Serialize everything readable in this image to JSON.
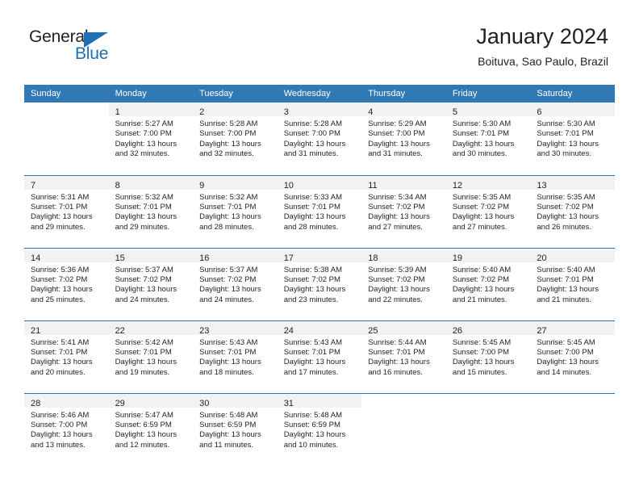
{
  "brand": {
    "name_part1": "General",
    "name_part2": "Blue",
    "accent_color": "#1f6fb4"
  },
  "header": {
    "title": "January 2024",
    "subtitle": "Boituva, Sao Paulo, Brazil"
  },
  "calendar": {
    "header_bg": "#3079b5",
    "daynum_bg": "#f2f2f2",
    "weekdays": [
      "Sunday",
      "Monday",
      "Tuesday",
      "Wednesday",
      "Thursday",
      "Friday",
      "Saturday"
    ],
    "weeks": [
      [
        {
          "day": "",
          "sunrise": "",
          "sunset": "",
          "daylight": ""
        },
        {
          "day": "1",
          "sunrise": "Sunrise: 5:27 AM",
          "sunset": "Sunset: 7:00 PM",
          "daylight": "Daylight: 13 hours and 32 minutes."
        },
        {
          "day": "2",
          "sunrise": "Sunrise: 5:28 AM",
          "sunset": "Sunset: 7:00 PM",
          "daylight": "Daylight: 13 hours and 32 minutes."
        },
        {
          "day": "3",
          "sunrise": "Sunrise: 5:28 AM",
          "sunset": "Sunset: 7:00 PM",
          "daylight": "Daylight: 13 hours and 31 minutes."
        },
        {
          "day": "4",
          "sunrise": "Sunrise: 5:29 AM",
          "sunset": "Sunset: 7:00 PM",
          "daylight": "Daylight: 13 hours and 31 minutes."
        },
        {
          "day": "5",
          "sunrise": "Sunrise: 5:30 AM",
          "sunset": "Sunset: 7:01 PM",
          "daylight": "Daylight: 13 hours and 30 minutes."
        },
        {
          "day": "6",
          "sunrise": "Sunrise: 5:30 AM",
          "sunset": "Sunset: 7:01 PM",
          "daylight": "Daylight: 13 hours and 30 minutes."
        }
      ],
      [
        {
          "day": "7",
          "sunrise": "Sunrise: 5:31 AM",
          "sunset": "Sunset: 7:01 PM",
          "daylight": "Daylight: 13 hours and 29 minutes."
        },
        {
          "day": "8",
          "sunrise": "Sunrise: 5:32 AM",
          "sunset": "Sunset: 7:01 PM",
          "daylight": "Daylight: 13 hours and 29 minutes."
        },
        {
          "day": "9",
          "sunrise": "Sunrise: 5:32 AM",
          "sunset": "Sunset: 7:01 PM",
          "daylight": "Daylight: 13 hours and 28 minutes."
        },
        {
          "day": "10",
          "sunrise": "Sunrise: 5:33 AM",
          "sunset": "Sunset: 7:01 PM",
          "daylight": "Daylight: 13 hours and 28 minutes."
        },
        {
          "day": "11",
          "sunrise": "Sunrise: 5:34 AM",
          "sunset": "Sunset: 7:02 PM",
          "daylight": "Daylight: 13 hours and 27 minutes."
        },
        {
          "day": "12",
          "sunrise": "Sunrise: 5:35 AM",
          "sunset": "Sunset: 7:02 PM",
          "daylight": "Daylight: 13 hours and 27 minutes."
        },
        {
          "day": "13",
          "sunrise": "Sunrise: 5:35 AM",
          "sunset": "Sunset: 7:02 PM",
          "daylight": "Daylight: 13 hours and 26 minutes."
        }
      ],
      [
        {
          "day": "14",
          "sunrise": "Sunrise: 5:36 AM",
          "sunset": "Sunset: 7:02 PM",
          "daylight": "Daylight: 13 hours and 25 minutes."
        },
        {
          "day": "15",
          "sunrise": "Sunrise: 5:37 AM",
          "sunset": "Sunset: 7:02 PM",
          "daylight": "Daylight: 13 hours and 24 minutes."
        },
        {
          "day": "16",
          "sunrise": "Sunrise: 5:37 AM",
          "sunset": "Sunset: 7:02 PM",
          "daylight": "Daylight: 13 hours and 24 minutes."
        },
        {
          "day": "17",
          "sunrise": "Sunrise: 5:38 AM",
          "sunset": "Sunset: 7:02 PM",
          "daylight": "Daylight: 13 hours and 23 minutes."
        },
        {
          "day": "18",
          "sunrise": "Sunrise: 5:39 AM",
          "sunset": "Sunset: 7:02 PM",
          "daylight": "Daylight: 13 hours and 22 minutes."
        },
        {
          "day": "19",
          "sunrise": "Sunrise: 5:40 AM",
          "sunset": "Sunset: 7:02 PM",
          "daylight": "Daylight: 13 hours and 21 minutes."
        },
        {
          "day": "20",
          "sunrise": "Sunrise: 5:40 AM",
          "sunset": "Sunset: 7:01 PM",
          "daylight": "Daylight: 13 hours and 21 minutes."
        }
      ],
      [
        {
          "day": "21",
          "sunrise": "Sunrise: 5:41 AM",
          "sunset": "Sunset: 7:01 PM",
          "daylight": "Daylight: 13 hours and 20 minutes."
        },
        {
          "day": "22",
          "sunrise": "Sunrise: 5:42 AM",
          "sunset": "Sunset: 7:01 PM",
          "daylight": "Daylight: 13 hours and 19 minutes."
        },
        {
          "day": "23",
          "sunrise": "Sunrise: 5:43 AM",
          "sunset": "Sunset: 7:01 PM",
          "daylight": "Daylight: 13 hours and 18 minutes."
        },
        {
          "day": "24",
          "sunrise": "Sunrise: 5:43 AM",
          "sunset": "Sunset: 7:01 PM",
          "daylight": "Daylight: 13 hours and 17 minutes."
        },
        {
          "day": "25",
          "sunrise": "Sunrise: 5:44 AM",
          "sunset": "Sunset: 7:01 PM",
          "daylight": "Daylight: 13 hours and 16 minutes."
        },
        {
          "day": "26",
          "sunrise": "Sunrise: 5:45 AM",
          "sunset": "Sunset: 7:00 PM",
          "daylight": "Daylight: 13 hours and 15 minutes."
        },
        {
          "day": "27",
          "sunrise": "Sunrise: 5:45 AM",
          "sunset": "Sunset: 7:00 PM",
          "daylight": "Daylight: 13 hours and 14 minutes."
        }
      ],
      [
        {
          "day": "28",
          "sunrise": "Sunrise: 5:46 AM",
          "sunset": "Sunset: 7:00 PM",
          "daylight": "Daylight: 13 hours and 13 minutes."
        },
        {
          "day": "29",
          "sunrise": "Sunrise: 5:47 AM",
          "sunset": "Sunset: 6:59 PM",
          "daylight": "Daylight: 13 hours and 12 minutes."
        },
        {
          "day": "30",
          "sunrise": "Sunrise: 5:48 AM",
          "sunset": "Sunset: 6:59 PM",
          "daylight": "Daylight: 13 hours and 11 minutes."
        },
        {
          "day": "31",
          "sunrise": "Sunrise: 5:48 AM",
          "sunset": "Sunset: 6:59 PM",
          "daylight": "Daylight: 13 hours and 10 minutes."
        },
        {
          "day": "",
          "sunrise": "",
          "sunset": "",
          "daylight": ""
        },
        {
          "day": "",
          "sunrise": "",
          "sunset": "",
          "daylight": ""
        },
        {
          "day": "",
          "sunrise": "",
          "sunset": "",
          "daylight": ""
        }
      ]
    ]
  }
}
